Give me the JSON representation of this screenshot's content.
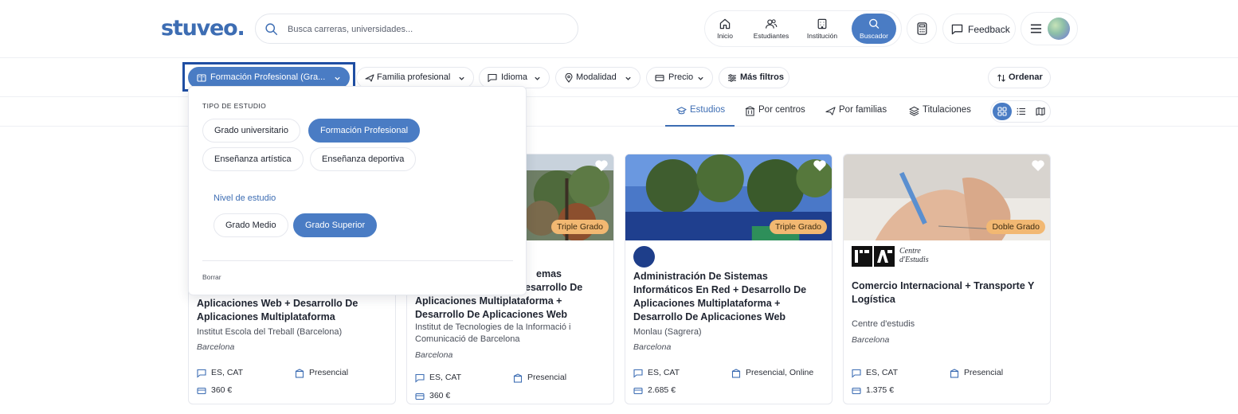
{
  "header": {
    "logo": "stuveo.",
    "search_placeholder": "Busca carreras, universidades...",
    "nav": [
      {
        "label": "Inicio",
        "icon": "home-icon"
      },
      {
        "label": "Estudiantes",
        "icon": "users-icon"
      },
      {
        "label": "Institución",
        "icon": "building-icon"
      },
      {
        "label": "Buscador",
        "icon": "search-icon",
        "active": true
      }
    ],
    "feedback_label": "Feedback"
  },
  "filters": {
    "study_type": "Formación Profesional (Gra...",
    "family": "Familia profesional",
    "language": "Idioma",
    "modality": "Modalidad",
    "price": "Precio",
    "more": "Más filtros",
    "sort": "Ordenar"
  },
  "tabs": {
    "studies": "Estudios",
    "centers": "Por centros",
    "families": "Por familias",
    "degrees": "Titulaciones"
  },
  "dropdown": {
    "section_title": "TIPO DE ESTUDIO",
    "types": [
      "Grado universitario",
      "Formación Profesional",
      "Enseñanza artística",
      "Enseñanza deportiva"
    ],
    "active_type": "Formación Profesional",
    "level_title": "Nivel de estudio",
    "levels": [
      "Grado Medio",
      "Grado Superior"
    ],
    "active_level": "Grado Superior",
    "clear_label": "Borrar"
  },
  "cards": [
    {
      "title_visible": "Aplicaciones Web + Desarrollo De Aplicaciones Multiplataforma",
      "center": "Institut Escola del Treball (Barcelona)",
      "city": "Barcelona",
      "languages": "ES, CAT",
      "modality": "Presencial",
      "price": "360 €"
    },
    {
      "badge": "Triple Grado",
      "title_partial_1": "emas",
      "title_partial_2": "esarrollo De",
      "title_line_3": "Aplicaciones Multiplataforma +",
      "title_line_4": "Desarrollo De Aplicaciones Web",
      "center": "Institut de Tecnologies de la Informació i Comunicació de Barcelona",
      "city": "Barcelona",
      "languages": "ES, CAT",
      "modality": "Presencial",
      "price": "360 €"
    },
    {
      "badge": "Triple Grado",
      "title": "Administración De Sistemas Informáticos En Red + Desarrollo De Aplicaciones Multiplataforma + Desarrollo De Aplicaciones Web",
      "center": "Monlau (Sagrera)",
      "city": "Barcelona",
      "languages": "ES, CAT",
      "modality": "Presencial, Online",
      "price": "2.685 €"
    },
    {
      "badge": "Doble Grado",
      "logo_text": "Centre d'Estudis",
      "title": "Comercio Internacional + Transporte Y Logística",
      "center": "Centre d'estudis",
      "city": "Barcelona",
      "languages": "ES, CAT",
      "modality": "Presencial",
      "price": "1.375 €"
    }
  ],
  "colors": {
    "brand": "#3d6db3",
    "accent": "#4a7cc4",
    "badge": "#f2b872",
    "highlight_border": "#1f4ea3"
  }
}
